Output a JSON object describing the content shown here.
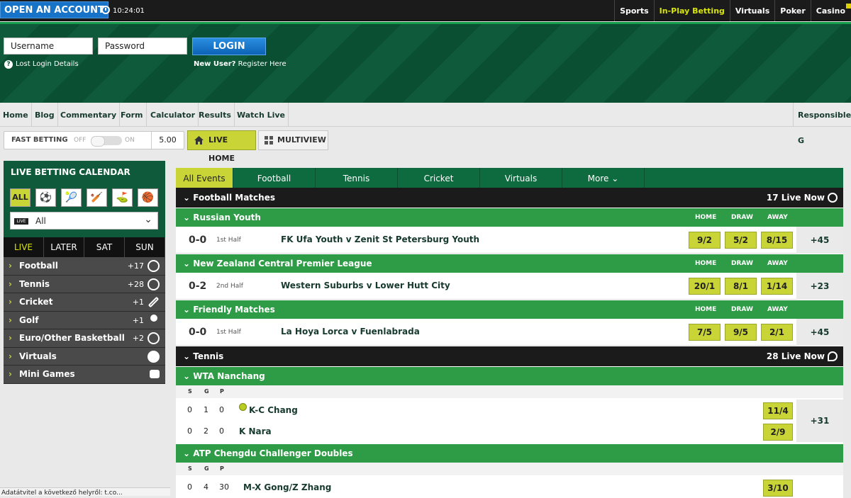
{
  "topbar": {
    "open_account": "OPEN AN ACCOUNT",
    "time": "10:24:01",
    "nav": [
      "Sports",
      "In-Play Betting",
      "Virtuals",
      "Poker",
      "Casino"
    ]
  },
  "login": {
    "username": "Username",
    "password": "Password",
    "button": "LOGIN",
    "lost": "Lost Login Details",
    "new_user_bold": "New User?",
    "register": " Register Here"
  },
  "subnav": [
    "Home",
    "Blog",
    "Commentary",
    "Form",
    "Calculator",
    "Results",
    "Watch Live",
    "Responsible G"
  ],
  "fast": {
    "label": "FAST BETTING",
    "off": "OFF",
    "on": "ON",
    "amount": "5.00",
    "live_home": "LIVE HOME",
    "multiview": "MULTIVIEW"
  },
  "calendar": {
    "title": "LIVE BETTING CALENDAR",
    "all": "ALL",
    "select": "All",
    "days": [
      "LIVE",
      "LATER",
      "SAT",
      "SUN"
    ],
    "sports": [
      {
        "name": "Football",
        "count": "+17"
      },
      {
        "name": "Tennis",
        "count": "+28"
      },
      {
        "name": "Cricket",
        "count": "+1"
      },
      {
        "name": "Golf",
        "count": "+1"
      },
      {
        "name": "Euro/Other Basketball",
        "count": "+2"
      },
      {
        "name": "Virtuals",
        "count": ""
      },
      {
        "name": "Mini Games",
        "count": ""
      }
    ]
  },
  "tabs": [
    "All Events",
    "Football",
    "Tennis",
    "Cricket",
    "Virtuals",
    "More"
  ],
  "football": {
    "title": "Football Matches",
    "live": "17 Live Now"
  },
  "headers": {
    "home": "HOME",
    "draw": "DRAW",
    "away": "AWAY"
  },
  "leagues": [
    {
      "name": "Russian Youth",
      "score": "0-0",
      "period": "1st Half",
      "match": "FK Ufa Youth v Zenit St Petersburg Youth",
      "odds": [
        "9/2",
        "5/2",
        "8/15"
      ],
      "more": "+45"
    },
    {
      "name": "New Zealand Central Premier League",
      "score": "0-2",
      "period": "2nd Half",
      "match": "Western Suburbs v Lower Hutt City",
      "odds": [
        "20/1",
        "8/1",
        "1/14"
      ],
      "more": "+23"
    },
    {
      "name": "Friendly Matches",
      "score": "0-0",
      "period": "1st Half",
      "match": "La Hoya Lorca v Fuenlabrada",
      "odds": [
        "7/5",
        "9/5",
        "2/1"
      ],
      "more": "+45"
    }
  ],
  "tennis": {
    "title": "Tennis",
    "live": "28 Live Now",
    "t1": {
      "name": "WTA Nanchang",
      "sgp": [
        "S",
        "G",
        "P"
      ],
      "p1": {
        "s": "0",
        "g": "1",
        "p": "0",
        "name": "K-C Chang",
        "odd": "11/4"
      },
      "p2": {
        "s": "0",
        "g": "2",
        "p": "0",
        "name": "K Nara",
        "odd": "2/9"
      },
      "more": "+31"
    },
    "t2": {
      "name": "ATP Chengdu Challenger Doubles",
      "sgp": [
        "S",
        "G",
        "P"
      ],
      "p1": {
        "s": "0",
        "g": "4",
        "p": "30",
        "name": "M-X Gong/Z Zhang",
        "odd": "3/10"
      }
    }
  },
  "status": "Adatátvitel a következő helyről: t.co..."
}
